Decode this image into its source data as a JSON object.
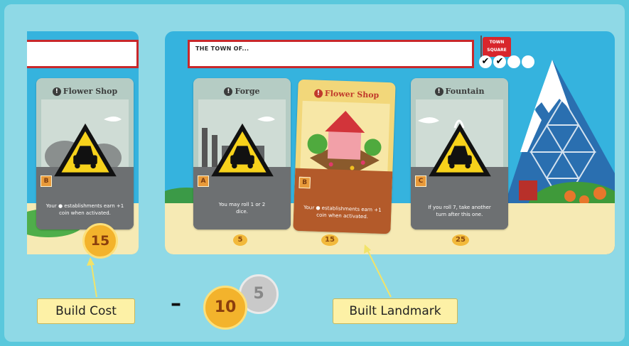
{
  "town": {
    "name_label": "THE TOWN OF..."
  },
  "flag": {
    "line1": "TOWN",
    "line2": "SQUARE"
  },
  "checks": [
    "✔",
    "✔",
    "",
    ""
  ],
  "left_card": {
    "title": "Flower Shop",
    "letter": "B",
    "desc": "Your ● establishments earn +1 coin when activated.",
    "cost": "15"
  },
  "cards": [
    {
      "title": "Forge",
      "letter": "A",
      "desc": "You may roll 1 or 2 dice.",
      "cost": "5"
    },
    {
      "title": "Flower Shop",
      "letter": "B",
      "desc": "Your ● establishments earn +1 coin when activated.",
      "cost": "15"
    },
    {
      "title": "Fountain",
      "letter": "C",
      "desc": "If you roll 7, take another turn after this one.",
      "cost": "25"
    }
  ],
  "labels": {
    "build_cost": "Build Cost",
    "built_landmark": "Built Landmark",
    "minus": "–"
  },
  "coins": {
    "gold": "10",
    "silver": "5"
  },
  "colors": {
    "background": "#5ac8dc",
    "built_card": "#f2d77a",
    "unbuilt_card": "#b5ccc4",
    "name_border": "#c8282b"
  }
}
